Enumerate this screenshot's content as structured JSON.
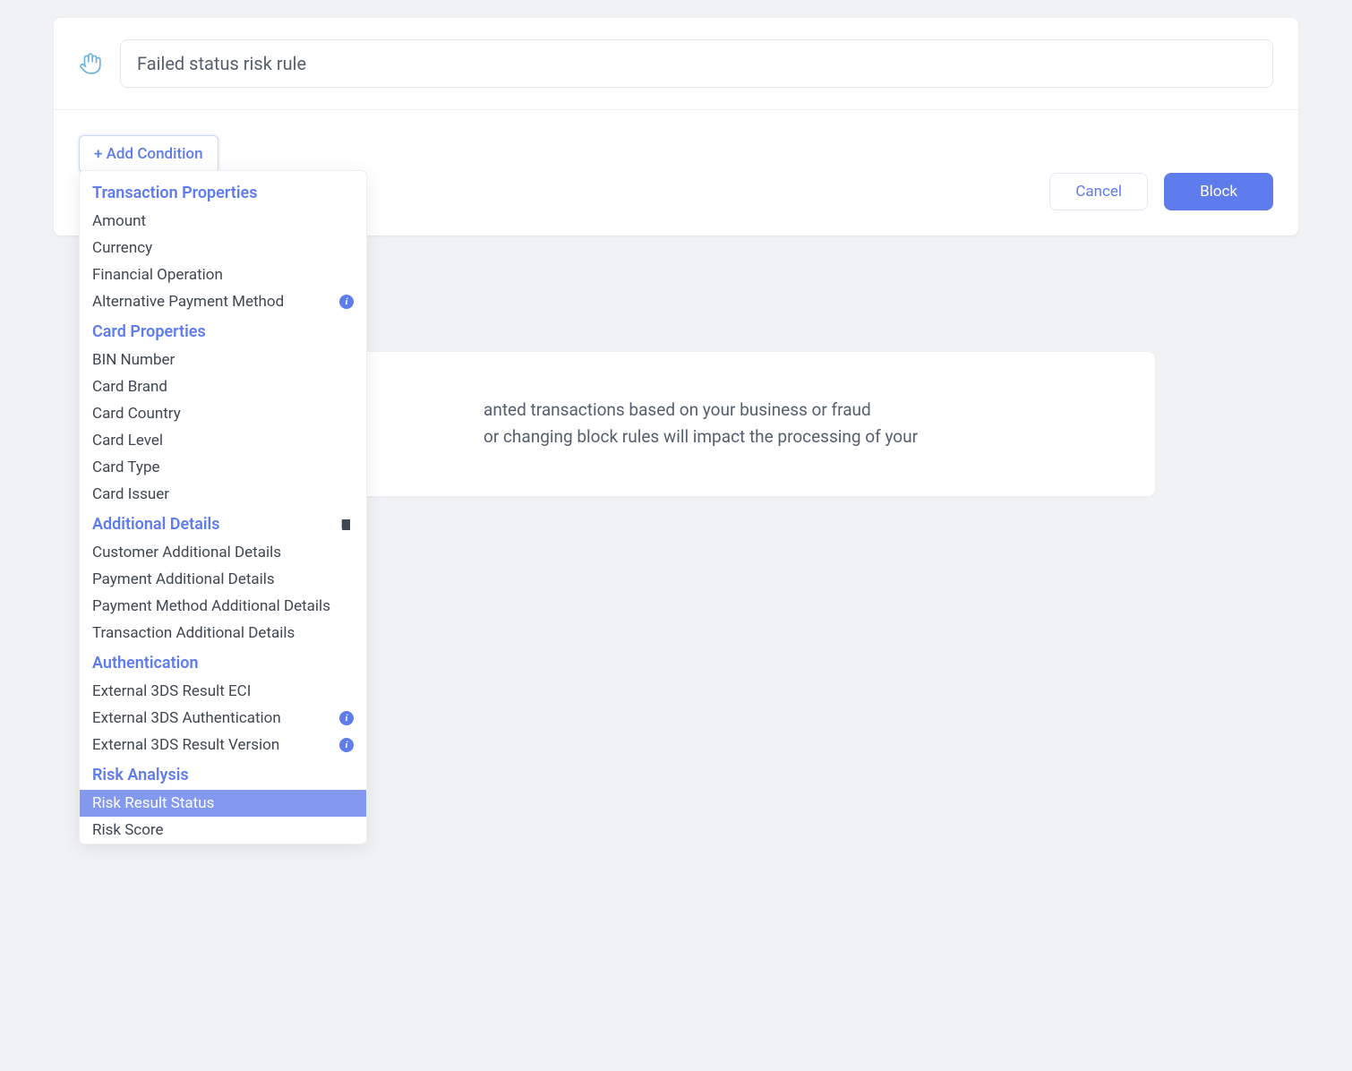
{
  "header": {
    "rule_name": "Failed status risk rule"
  },
  "buttons": {
    "add_condition": "+ Add Condition",
    "cancel": "Cancel",
    "block": "Block"
  },
  "dropdown": {
    "section1": {
      "title": "Transaction Properties",
      "items": [
        "Amount",
        "Currency",
        "Financial Operation",
        "Alternative Payment Method"
      ],
      "info_index": 3
    },
    "section2": {
      "title": "Card Properties",
      "items": [
        "BIN Number",
        "Card Brand",
        "Card Country",
        "Card Level",
        "Card Type",
        "Card Issuer"
      ]
    },
    "section3": {
      "title": "Additional Details",
      "items": [
        "Customer Additional Details",
        "Payment Additional Details",
        "Payment Method Additional Details",
        "Transaction Additional Details"
      ]
    },
    "section4": {
      "title": "Authentication",
      "items": [
        "External 3DS Result ECI",
        "External 3DS Authentication",
        "External 3DS Result Version"
      ],
      "info_indices": [
        1,
        2
      ]
    },
    "section5": {
      "title": "Risk Analysis",
      "items": [
        "Risk Result Status",
        "Risk Score"
      ],
      "selected_index": 0
    }
  },
  "info_block": {
    "text_fragment_1": "anted transactions based on your business or fraud",
    "text_fragment_2": "or changing block rules will impact the processing of your"
  }
}
